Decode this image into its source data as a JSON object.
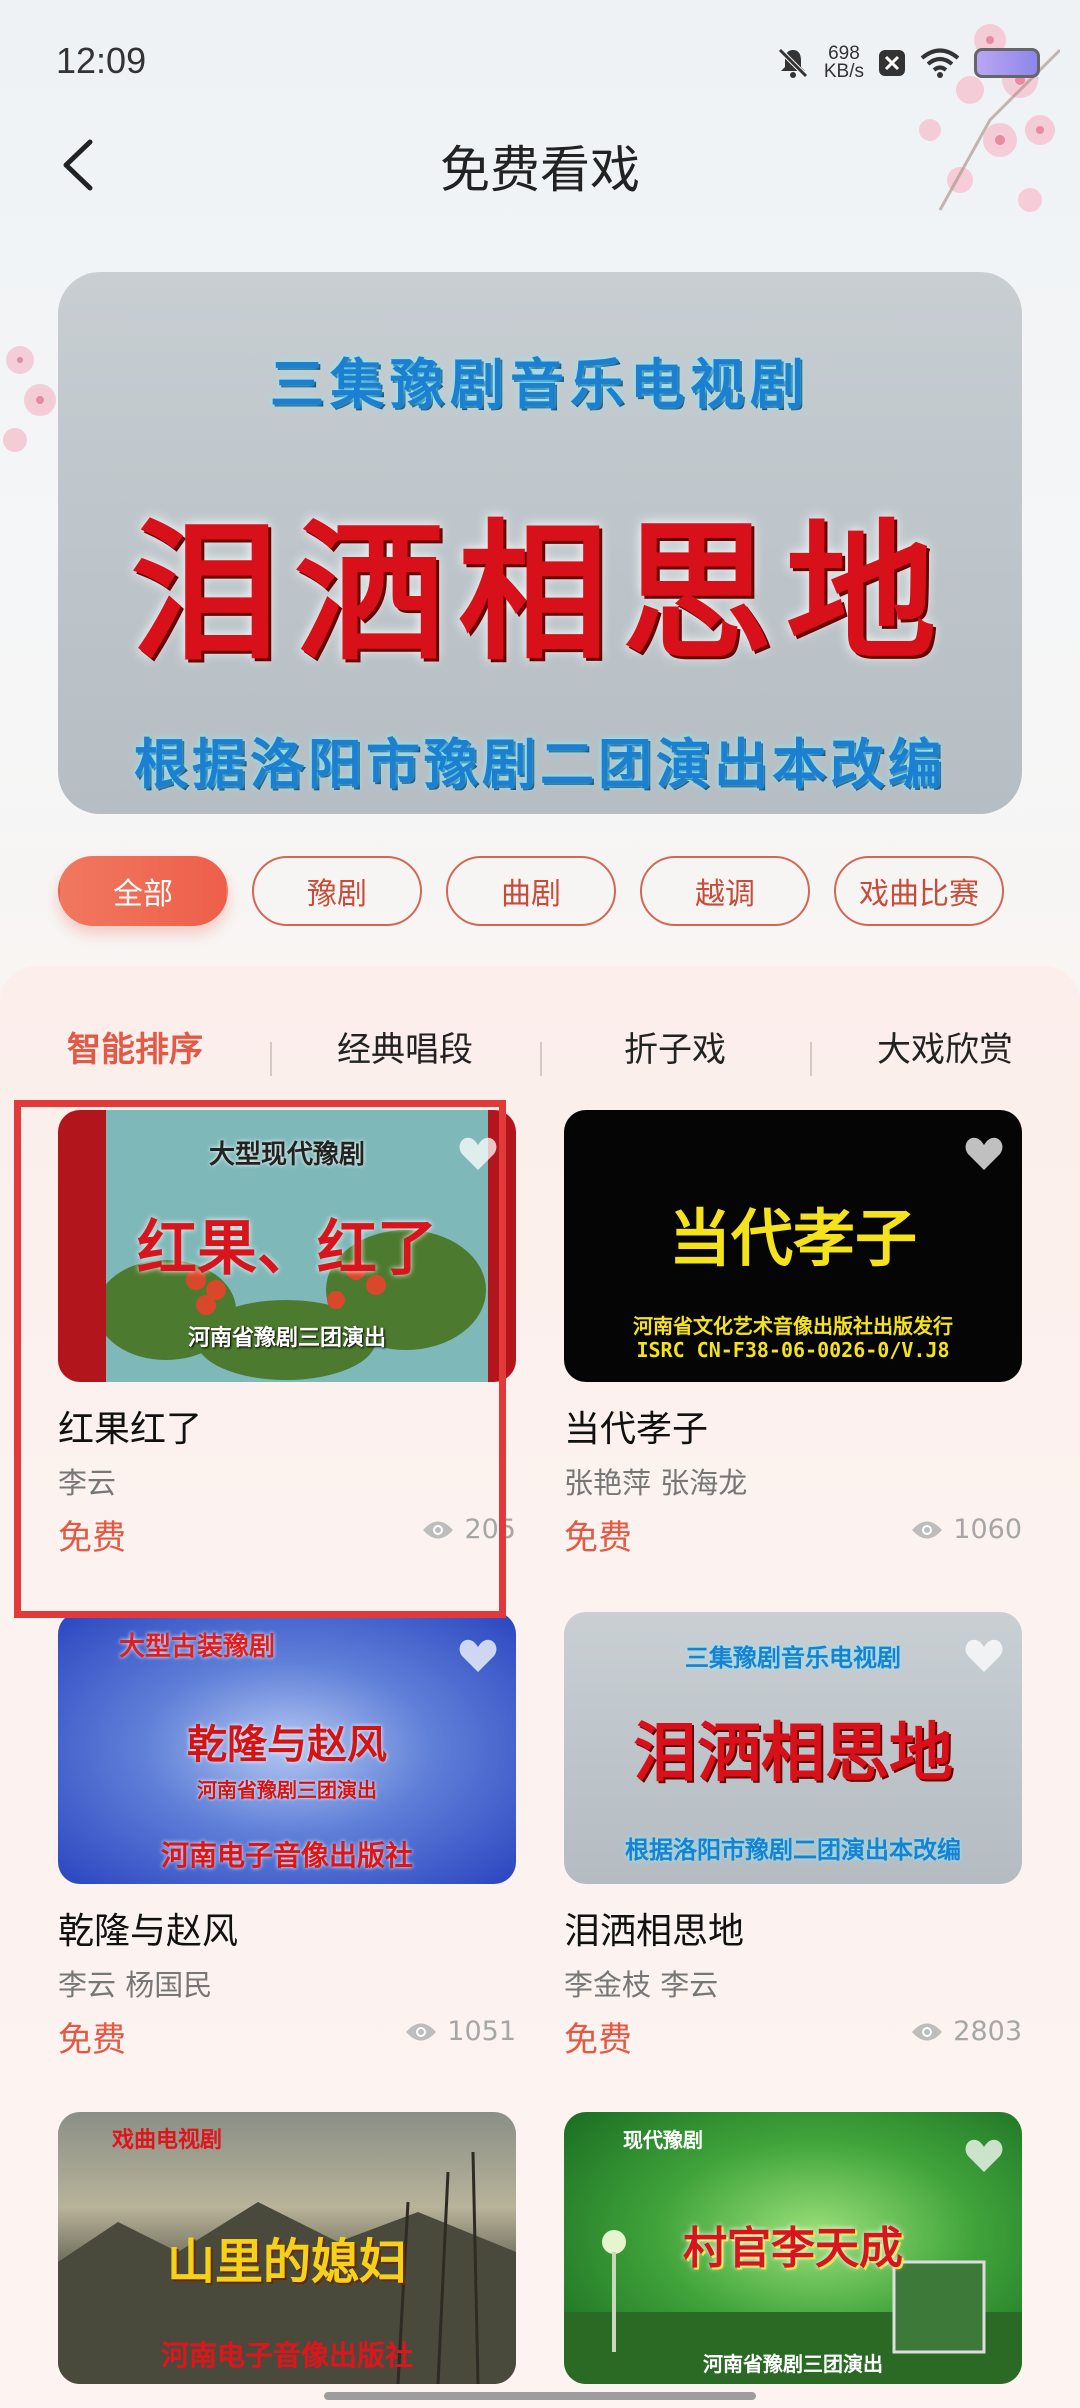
{
  "status_bar": {
    "time": "12:09",
    "net_speed_value": "698",
    "net_speed_unit": "KB/s",
    "icons": [
      "mute-icon",
      "close-app-icon",
      "wifi-icon",
      "battery-icon"
    ]
  },
  "header": {
    "title": "免费看戏"
  },
  "banner": {
    "subtitle": "三集豫剧音乐电视剧",
    "title": "泪洒相思地",
    "note": "根据洛阳市豫剧二团演出本改编"
  },
  "categories": [
    {
      "label": "全部",
      "active": true
    },
    {
      "label": "豫剧",
      "active": false
    },
    {
      "label": "曲剧",
      "active": false
    },
    {
      "label": "越调",
      "active": false
    },
    {
      "label": "戏曲比赛",
      "active": false
    }
  ],
  "sort_tabs": [
    {
      "label": "智能排序",
      "active": true
    },
    {
      "label": "经典唱段",
      "active": false
    },
    {
      "label": "折子戏",
      "active": false
    },
    {
      "label": "大戏欣赏",
      "active": false
    }
  ],
  "cards": [
    {
      "title": "红果红了",
      "artists": "李云",
      "price": "免费",
      "views": "205",
      "thumb": {
        "top": "大型现代豫剧",
        "main": "红果、红了",
        "bottom": "河南省豫剧三团演出"
      }
    },
    {
      "title": "当代孝子",
      "artists": "张艳萍 张海龙",
      "price": "免费",
      "views": "1060",
      "thumb": {
        "main": "当代孝子",
        "bottom": "河南省文化艺术音像出版社出版发行",
        "bottom2": "ISRC CN-F38-06-0026-0/V.J8"
      }
    },
    {
      "title": "乾隆与赵风",
      "artists": "李云 杨国民",
      "price": "免费",
      "views": "1051",
      "thumb": {
        "top": "大型古装豫剧",
        "main": "乾隆与赵风",
        "sub": "河南省豫剧三团演出",
        "bottom": "河南电子音像出版社"
      }
    },
    {
      "title": "泪洒相思地",
      "artists": "李金枝 李云",
      "price": "免费",
      "views": "2803",
      "thumb": {
        "top": "三集豫剧音乐电视剧",
        "main": "泪洒相思地",
        "bottom": "根据洛阳市豫剧二团演出本改编"
      }
    },
    {
      "thumb": {
        "top": "戏曲电视剧",
        "main": "山里的媳妇",
        "bottom": "河南电子音像出版社"
      }
    },
    {
      "thumb": {
        "top": "现代豫剧",
        "main": "村官李天成",
        "bottom": "河南省豫剧三团演出"
      }
    }
  ],
  "colors": {
    "accent": "#e25a45",
    "chip_border": "#d06855",
    "selection": "#e23a3a"
  }
}
